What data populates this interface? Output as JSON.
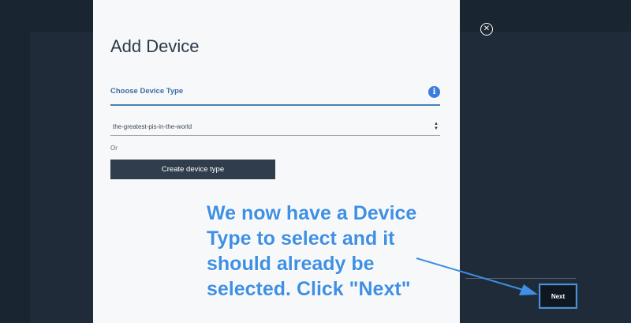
{
  "modal": {
    "title": "Add Device",
    "section_label": "Choose Device Type",
    "info_icon": "info-icon",
    "device_type_select": {
      "selected_value": "the-greatest-pis-in-the-world"
    },
    "or_label": "Or",
    "create_button_label": "Create device type"
  },
  "close_icon": "close-icon",
  "footer": {
    "next_label": "Next"
  },
  "annotation": {
    "text": "We now have a Device Type to select and it should already be selected. Click \"Next\"",
    "color": "#3f8fe3"
  },
  "colors": {
    "backdrop": "#1a2532",
    "modal_background": "#f7f8f9",
    "accent": "#4a7fb5",
    "button_dark": "#2f3d4c"
  }
}
